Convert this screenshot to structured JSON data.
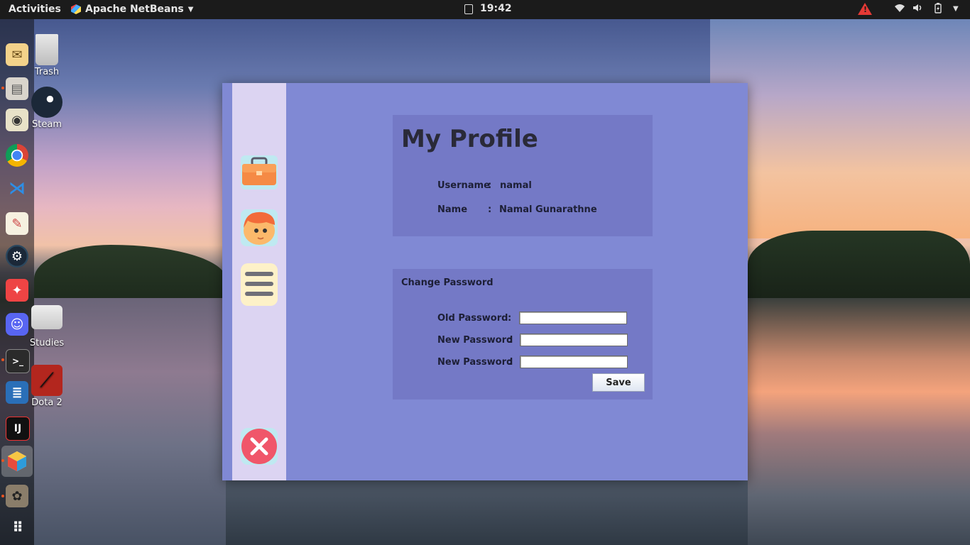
{
  "topbar": {
    "activities": "Activities",
    "app_name": "Apache NetBeans",
    "time": "19:42"
  },
  "dock": {
    "items": [
      "mail-icon",
      "file-manager-icon",
      "sound-icon",
      "chrome-icon",
      "vscode-icon",
      "text-editor-icon",
      "steam-icon",
      "settings-icon",
      "discord-icon",
      "terminal-icon",
      "writer-icon",
      "intellij-icon",
      "netbeans-icon",
      "gimp-icon",
      "app-grid-icon"
    ]
  },
  "desktop": {
    "trash": "Trash",
    "steam": "Steam",
    "studies": "Studies",
    "dota": "Dota 2"
  },
  "profile": {
    "title": "My Profile",
    "username_label": "Username",
    "username_colon": ":",
    "username_value": "namal",
    "name_label": "Name",
    "name_colon": ":",
    "name_value": "Namal Gunarathne"
  },
  "password": {
    "title": "Change Password",
    "old_label": "Old Password",
    "old_colon": ":",
    "new_label": "New Password",
    "new_colon": ":",
    "confirm_label": "New Password",
    "confirm_colon": ":",
    "old_value": "",
    "new_value": "",
    "confirm_value": "",
    "save_label": "Save"
  },
  "colors": {
    "window_bg": "#8089d4",
    "panel_bg": "#7479c6",
    "sidebar_bg": "#dcd4f2",
    "close_red": "#f0566a"
  }
}
